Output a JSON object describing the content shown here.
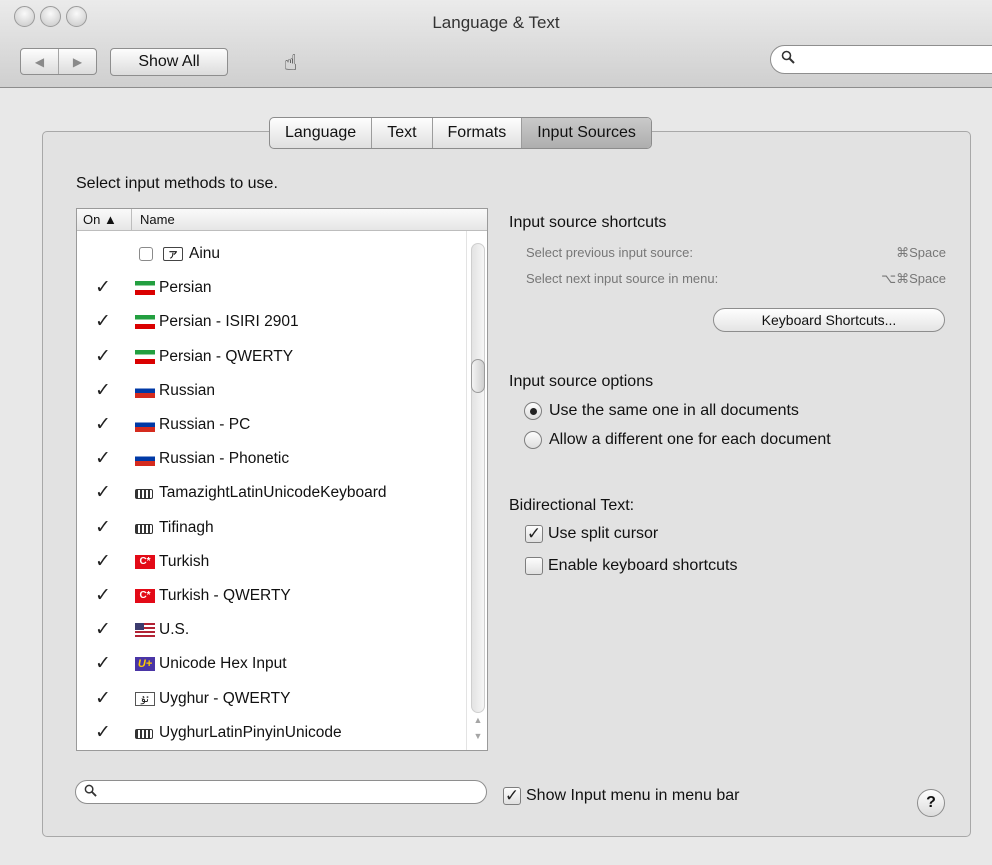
{
  "window": {
    "title": "Language & Text"
  },
  "toolbar": {
    "back_glyph": "◀",
    "forward_glyph": "▶",
    "show_all": "Show All",
    "cursor_glyph": "☝",
    "search_value": "",
    "search_glyph": "🔍"
  },
  "tabs": [
    {
      "label": "Language",
      "selected": false
    },
    {
      "label": "Text",
      "selected": false
    },
    {
      "label": "Formats",
      "selected": false
    },
    {
      "label": "Input Sources",
      "selected": true
    }
  ],
  "input_sources": {
    "prompt": "Select input methods to use.",
    "columns": {
      "on": "On ▲",
      "name": "Name"
    },
    "items": [
      {
        "name": "Ainu",
        "checked": false,
        "icon": "ainu-icon",
        "icon_text": "ア"
      },
      {
        "name": "Persian",
        "checked": true,
        "icon": "flag-iran-icon",
        "icon_text": ""
      },
      {
        "name": "Persian - ISIRI 2901",
        "checked": true,
        "icon": "flag-iran-icon",
        "icon_text": ""
      },
      {
        "name": "Persian - QWERTY",
        "checked": true,
        "icon": "flag-iran-icon",
        "icon_text": ""
      },
      {
        "name": "Russian",
        "checked": true,
        "icon": "flag-russia-icon",
        "icon_text": ""
      },
      {
        "name": "Russian - PC",
        "checked": true,
        "icon": "flag-russia-icon",
        "icon_text": ""
      },
      {
        "name": "Russian - Phonetic",
        "checked": true,
        "icon": "flag-russia-icon",
        "icon_text": ""
      },
      {
        "name": "TamazightLatinUnicodeKeyboard",
        "checked": true,
        "icon": "keyboard-icon",
        "icon_text": ""
      },
      {
        "name": "Tifinagh",
        "checked": true,
        "icon": "keyboard-icon",
        "icon_text": ""
      },
      {
        "name": "Turkish",
        "checked": true,
        "icon": "flag-turkey-icon",
        "icon_text": "C*"
      },
      {
        "name": "Turkish - QWERTY",
        "checked": true,
        "icon": "flag-turkey-icon",
        "icon_text": "C*"
      },
      {
        "name": "U.S.",
        "checked": true,
        "icon": "flag-us-icon",
        "icon_text": ""
      },
      {
        "name": "Unicode Hex Input",
        "checked": true,
        "icon": "unicode-hex-icon",
        "icon_text": "U+"
      },
      {
        "name": "Uyghur - QWERTY",
        "checked": true,
        "icon": "uyghur-icon",
        "icon_text": "ئۇ"
      },
      {
        "name": "UyghurLatinPinyinUnicode",
        "checked": true,
        "icon": "keyboard-icon",
        "icon_text": ""
      }
    ],
    "check_glyph": "✓",
    "filter_value": ""
  },
  "shortcuts": {
    "heading": "Input source shortcuts",
    "rows": [
      {
        "label": "Select previous input source:",
        "key": "⌘Space"
      },
      {
        "label": "Select next input source in menu:",
        "key": "⌥⌘Space"
      }
    ],
    "button": "Keyboard Shortcuts..."
  },
  "options": {
    "heading": "Input source options",
    "radios": [
      {
        "label": "Use the same one in all documents",
        "selected": true
      },
      {
        "label": "Allow a different one for each document",
        "selected": false
      }
    ]
  },
  "bidi": {
    "heading": "Bidirectional Text:",
    "checkboxes": [
      {
        "label": "Use split cursor",
        "checked": true
      },
      {
        "label": "Enable keyboard shortcuts",
        "checked": false
      }
    ]
  },
  "footer": {
    "show_menu_label": "Show Input menu in menu bar",
    "show_menu_checked": true,
    "help_glyph": "?"
  }
}
